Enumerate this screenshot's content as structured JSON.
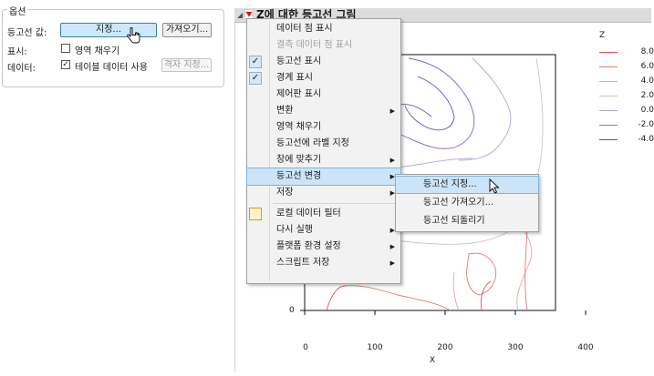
{
  "options": {
    "group_title": "옵션",
    "contour_values_label": "등고선 값:",
    "specify_button": "지정...",
    "retrieve_button": "가져오기...",
    "display_label": "표시:",
    "fill_areas_label": "영역 채우기",
    "fill_areas_checked": false,
    "data_label": "데이터:",
    "use_table_data_label": "테이블 데이터 사용",
    "use_table_data_checked": true,
    "grid_specify_button": "격자 지정..."
  },
  "report": {
    "title": "Z에 대한 등고선 그림",
    "disclosure_icon": "disclosure-triangle-icon",
    "red_triangle_icon": "red-triangle-menu-icon"
  },
  "legend": {
    "title": "Z",
    "items": [
      {
        "value": "8.0",
        "color": "#e05050"
      },
      {
        "value": "6.0",
        "color": "#e07a7a"
      },
      {
        "value": "4.0",
        "color": "#e3a8a8"
      },
      {
        "value": "2.0",
        "color": "#c8c8c8"
      },
      {
        "value": "0.0",
        "color": "#a9a9e0"
      },
      {
        "value": "-2.0",
        "color": "#7a7ad8"
      },
      {
        "value": "-4.0",
        "color": "#4f4fd0"
      }
    ]
  },
  "axes": {
    "x_title": "X",
    "x_ticks": [
      "0",
      "100",
      "200",
      "300",
      "400"
    ],
    "y_ticks": [
      "0"
    ]
  },
  "menu": {
    "items": [
      {
        "label": "데이터 점 표시",
        "checked": false,
        "disabled": false,
        "submenu": false
      },
      {
        "label": "결측 데이터 점 표시",
        "checked": false,
        "disabled": true,
        "submenu": false
      },
      {
        "label": "등고선 표시",
        "checked": true,
        "disabled": false,
        "submenu": false
      },
      {
        "label": "경계 표시",
        "checked": true,
        "disabled": false,
        "submenu": false
      },
      {
        "label": "제어판 표시",
        "checked": false,
        "disabled": false,
        "submenu": false
      },
      {
        "label": "변환",
        "checked": false,
        "disabled": false,
        "submenu": true
      },
      {
        "label": "영역 채우기",
        "checked": false,
        "disabled": false,
        "submenu": false
      },
      {
        "label": "등고선에 라벨 지정",
        "checked": false,
        "disabled": false,
        "submenu": false
      },
      {
        "label": "창에 맞추기",
        "checked": false,
        "disabled": false,
        "submenu": true
      },
      {
        "label": "등고선 변경",
        "checked": false,
        "disabled": false,
        "submenu": true,
        "highlighted": true
      },
      {
        "label": "저장",
        "checked": false,
        "disabled": false,
        "submenu": true
      },
      {
        "label": "로컬 데이터 필터",
        "checked": false,
        "disabled": false,
        "submenu": false,
        "icon": "local-data-filter-icon"
      },
      {
        "label": "다시 실행",
        "checked": false,
        "disabled": false,
        "submenu": true
      },
      {
        "label": "플랫폼 환경 설정",
        "checked": false,
        "disabled": false,
        "submenu": true
      },
      {
        "label": "스크립트 저장",
        "checked": false,
        "disabled": false,
        "submenu": true
      }
    ],
    "checkmark": "✓",
    "submenu_arrow": "▶"
  },
  "submenu": {
    "items": [
      {
        "label": "등고선 지정...",
        "highlighted": true
      },
      {
        "label": "등고선 가져오기..."
      },
      {
        "label": "등고선 되돌리기"
      }
    ]
  },
  "cursor_icons": [
    "hand-cursor-icon",
    "arrow-cursor-icon"
  ]
}
